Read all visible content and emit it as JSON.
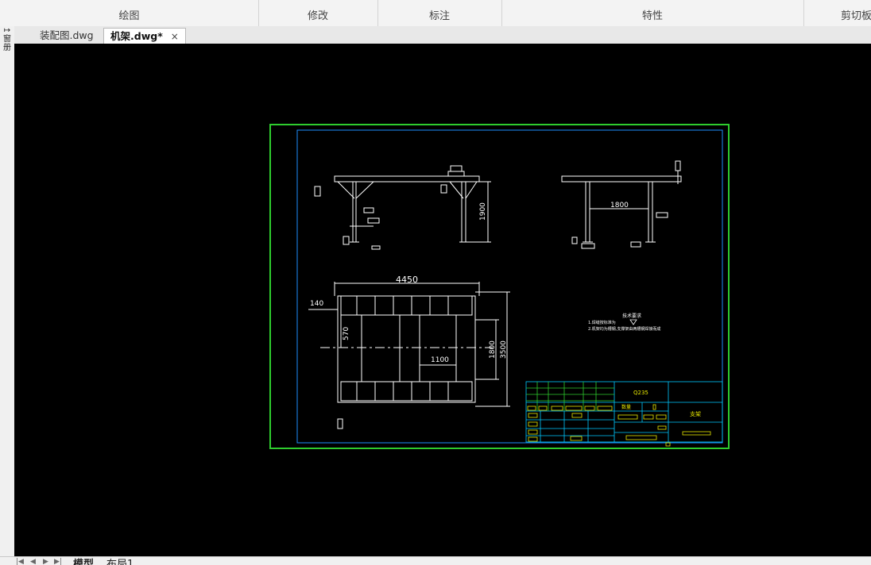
{
  "ribbon": {
    "groups": [
      {
        "id": "draw",
        "label": "绘图"
      },
      {
        "id": "modify",
        "label": "修改"
      },
      {
        "id": "annotate",
        "label": "标注"
      },
      {
        "id": "properties",
        "label": "特性"
      },
      {
        "id": "clipboard",
        "label": "剪切板"
      }
    ]
  },
  "tabs": [
    {
      "label": "装配图.dwg",
      "active": false
    },
    {
      "label": "机架.dwg*",
      "active": true,
      "close": "×"
    }
  ],
  "left_toolbar": {
    "chars": [
      "↦",
      "窗",
      "册"
    ]
  },
  "layout_tabs": {
    "model": "模型",
    "layout1": "布局1"
  },
  "drawing": {
    "dims": {
      "d1900": "1900",
      "d1800a": "1800",
      "d4450": "4450",
      "d140": "140",
      "d570": "570",
      "d1100": "1100",
      "d1800b": "1800",
      "d3500": "3500"
    },
    "notes": {
      "title": "技术要求",
      "line1": "1.焊缝按标准为",
      "line2": "2.机架均为槽钢,支撑架由两槽钢焊接而成"
    },
    "title_block": {
      "material": "Q235",
      "qty": "数量",
      "name": "支架"
    },
    "colors": {
      "border": "#2ecc2e",
      "frame": "#1e90ff",
      "lines": "#ffffff",
      "titleblock": "#00c8ff",
      "yellow": "#e6e600"
    }
  }
}
